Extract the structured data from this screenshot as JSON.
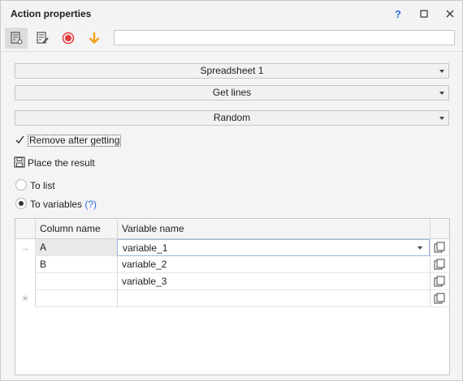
{
  "window": {
    "title": "Action properties",
    "help_label": "?"
  },
  "toolbar": {
    "tools": [
      "settings-doc-icon",
      "edit-doc-icon",
      "record-icon",
      "download-arrow-icon"
    ],
    "input_value": ""
  },
  "form": {
    "table_select": "Spreadsheet 1",
    "action_select": "Get lines",
    "mode_select": "Random",
    "remove_after_getting": {
      "label": "Remove after getting",
      "checked": true
    },
    "place_result_label": "Place the result",
    "to_list_label": "To list",
    "to_variables_label": "To variables",
    "to_variables_help": "(?)",
    "selected_option": "To variables"
  },
  "grid": {
    "columns": [
      "Column name",
      "Variable name"
    ],
    "rows": [
      {
        "indicator": "→",
        "column": "A",
        "variable": "variable_1"
      },
      {
        "indicator": "",
        "column": "B",
        "variable": "variable_2"
      },
      {
        "indicator": "",
        "column": "",
        "variable": "variable_3"
      },
      {
        "indicator": "✳",
        "column": "",
        "variable": ""
      }
    ]
  },
  "colors": {
    "accent": "#2a6ee0",
    "record": "#e23b3b",
    "arrow": "#f0a020"
  }
}
